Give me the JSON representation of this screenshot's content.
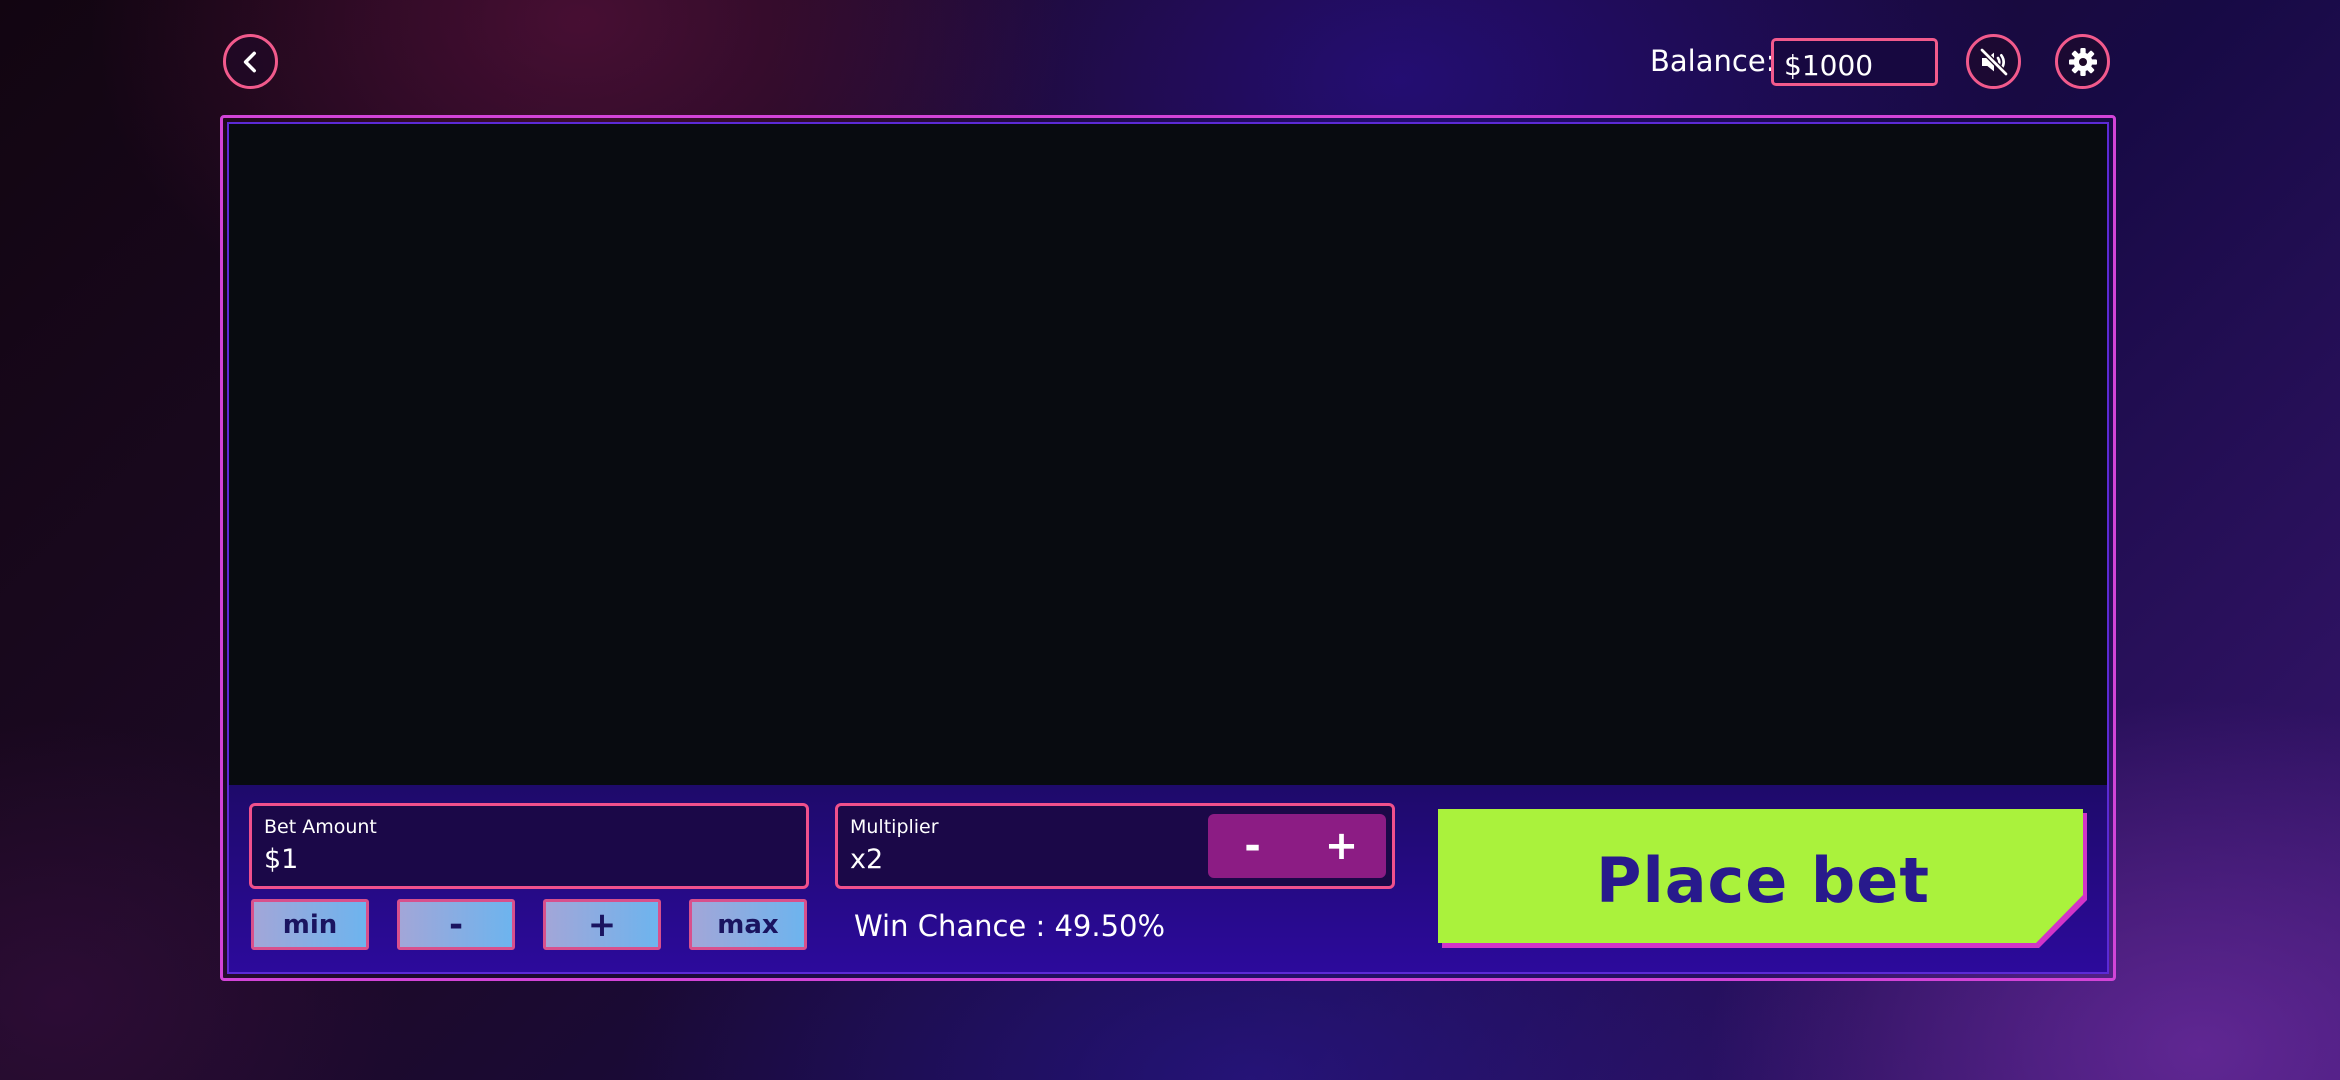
{
  "header": {
    "back_icon": "chevron-left-icon",
    "balance_label": "Balance:",
    "balance_value": "$1000",
    "sound_icon": "volume-muted-icon",
    "settings_icon": "gear-icon"
  },
  "bet": {
    "label": "Bet Amount",
    "value": "$1",
    "min_label": "min",
    "minus_label": "-",
    "plus_label": "+",
    "max_label": "max"
  },
  "multiplier": {
    "label": "Multiplier",
    "value": "x2",
    "minus_label": "-",
    "plus_label": "+"
  },
  "win_chance": "Win Chance : 49.50%",
  "place_bet_label": "Place bet",
  "colors": {
    "accent_pink": "#f25a8c",
    "frame_purple": "#d244d8",
    "place_bet_green": "#aaf23c",
    "place_bet_text": "#281a8c",
    "stepper_bg": "#8c1c84"
  }
}
